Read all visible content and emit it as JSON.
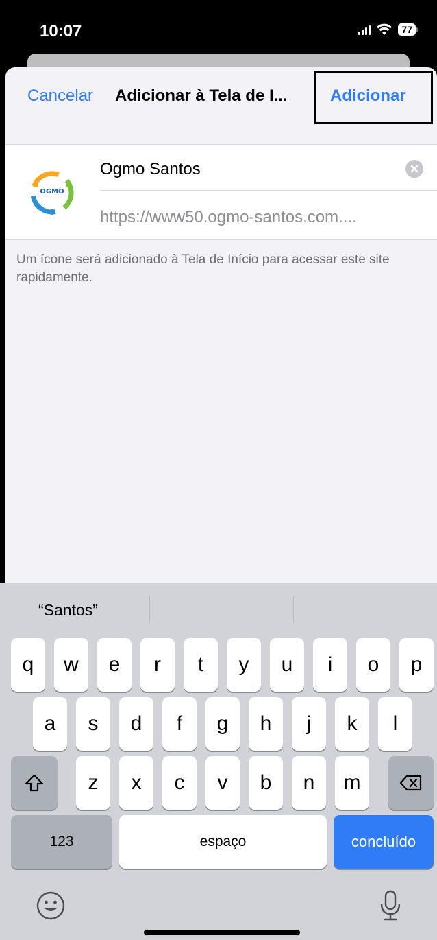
{
  "status_bar": {
    "time": "10:07",
    "battery": "77"
  },
  "nav": {
    "cancel_label": "Cancelar",
    "title": "Adicionar à Tela de I...",
    "add_label": "Adicionar"
  },
  "site": {
    "name_value": "Ogmo Santos",
    "url": "https://www50.ogmo-santos.com....",
    "icon_text": "OGMO"
  },
  "hint": "Um ícone será adicionado à Tela de Início para acessar este site rapidamente.",
  "keyboard": {
    "suggestion": "“Santos”",
    "row1": [
      "q",
      "w",
      "e",
      "r",
      "t",
      "y",
      "u",
      "i",
      "o",
      "p"
    ],
    "row2": [
      "a",
      "s",
      "d",
      "f",
      "g",
      "h",
      "j",
      "k",
      "l"
    ],
    "row3": [
      "z",
      "x",
      "c",
      "v",
      "b",
      "n",
      "m"
    ],
    "numbers_label": "123",
    "space_label": "espaço",
    "done_label": "concluído"
  },
  "colors": {
    "accent": "#2f7cf6",
    "sheet_bg": "#f2f2f7",
    "keyboard_bg": "#d1d3d9"
  }
}
